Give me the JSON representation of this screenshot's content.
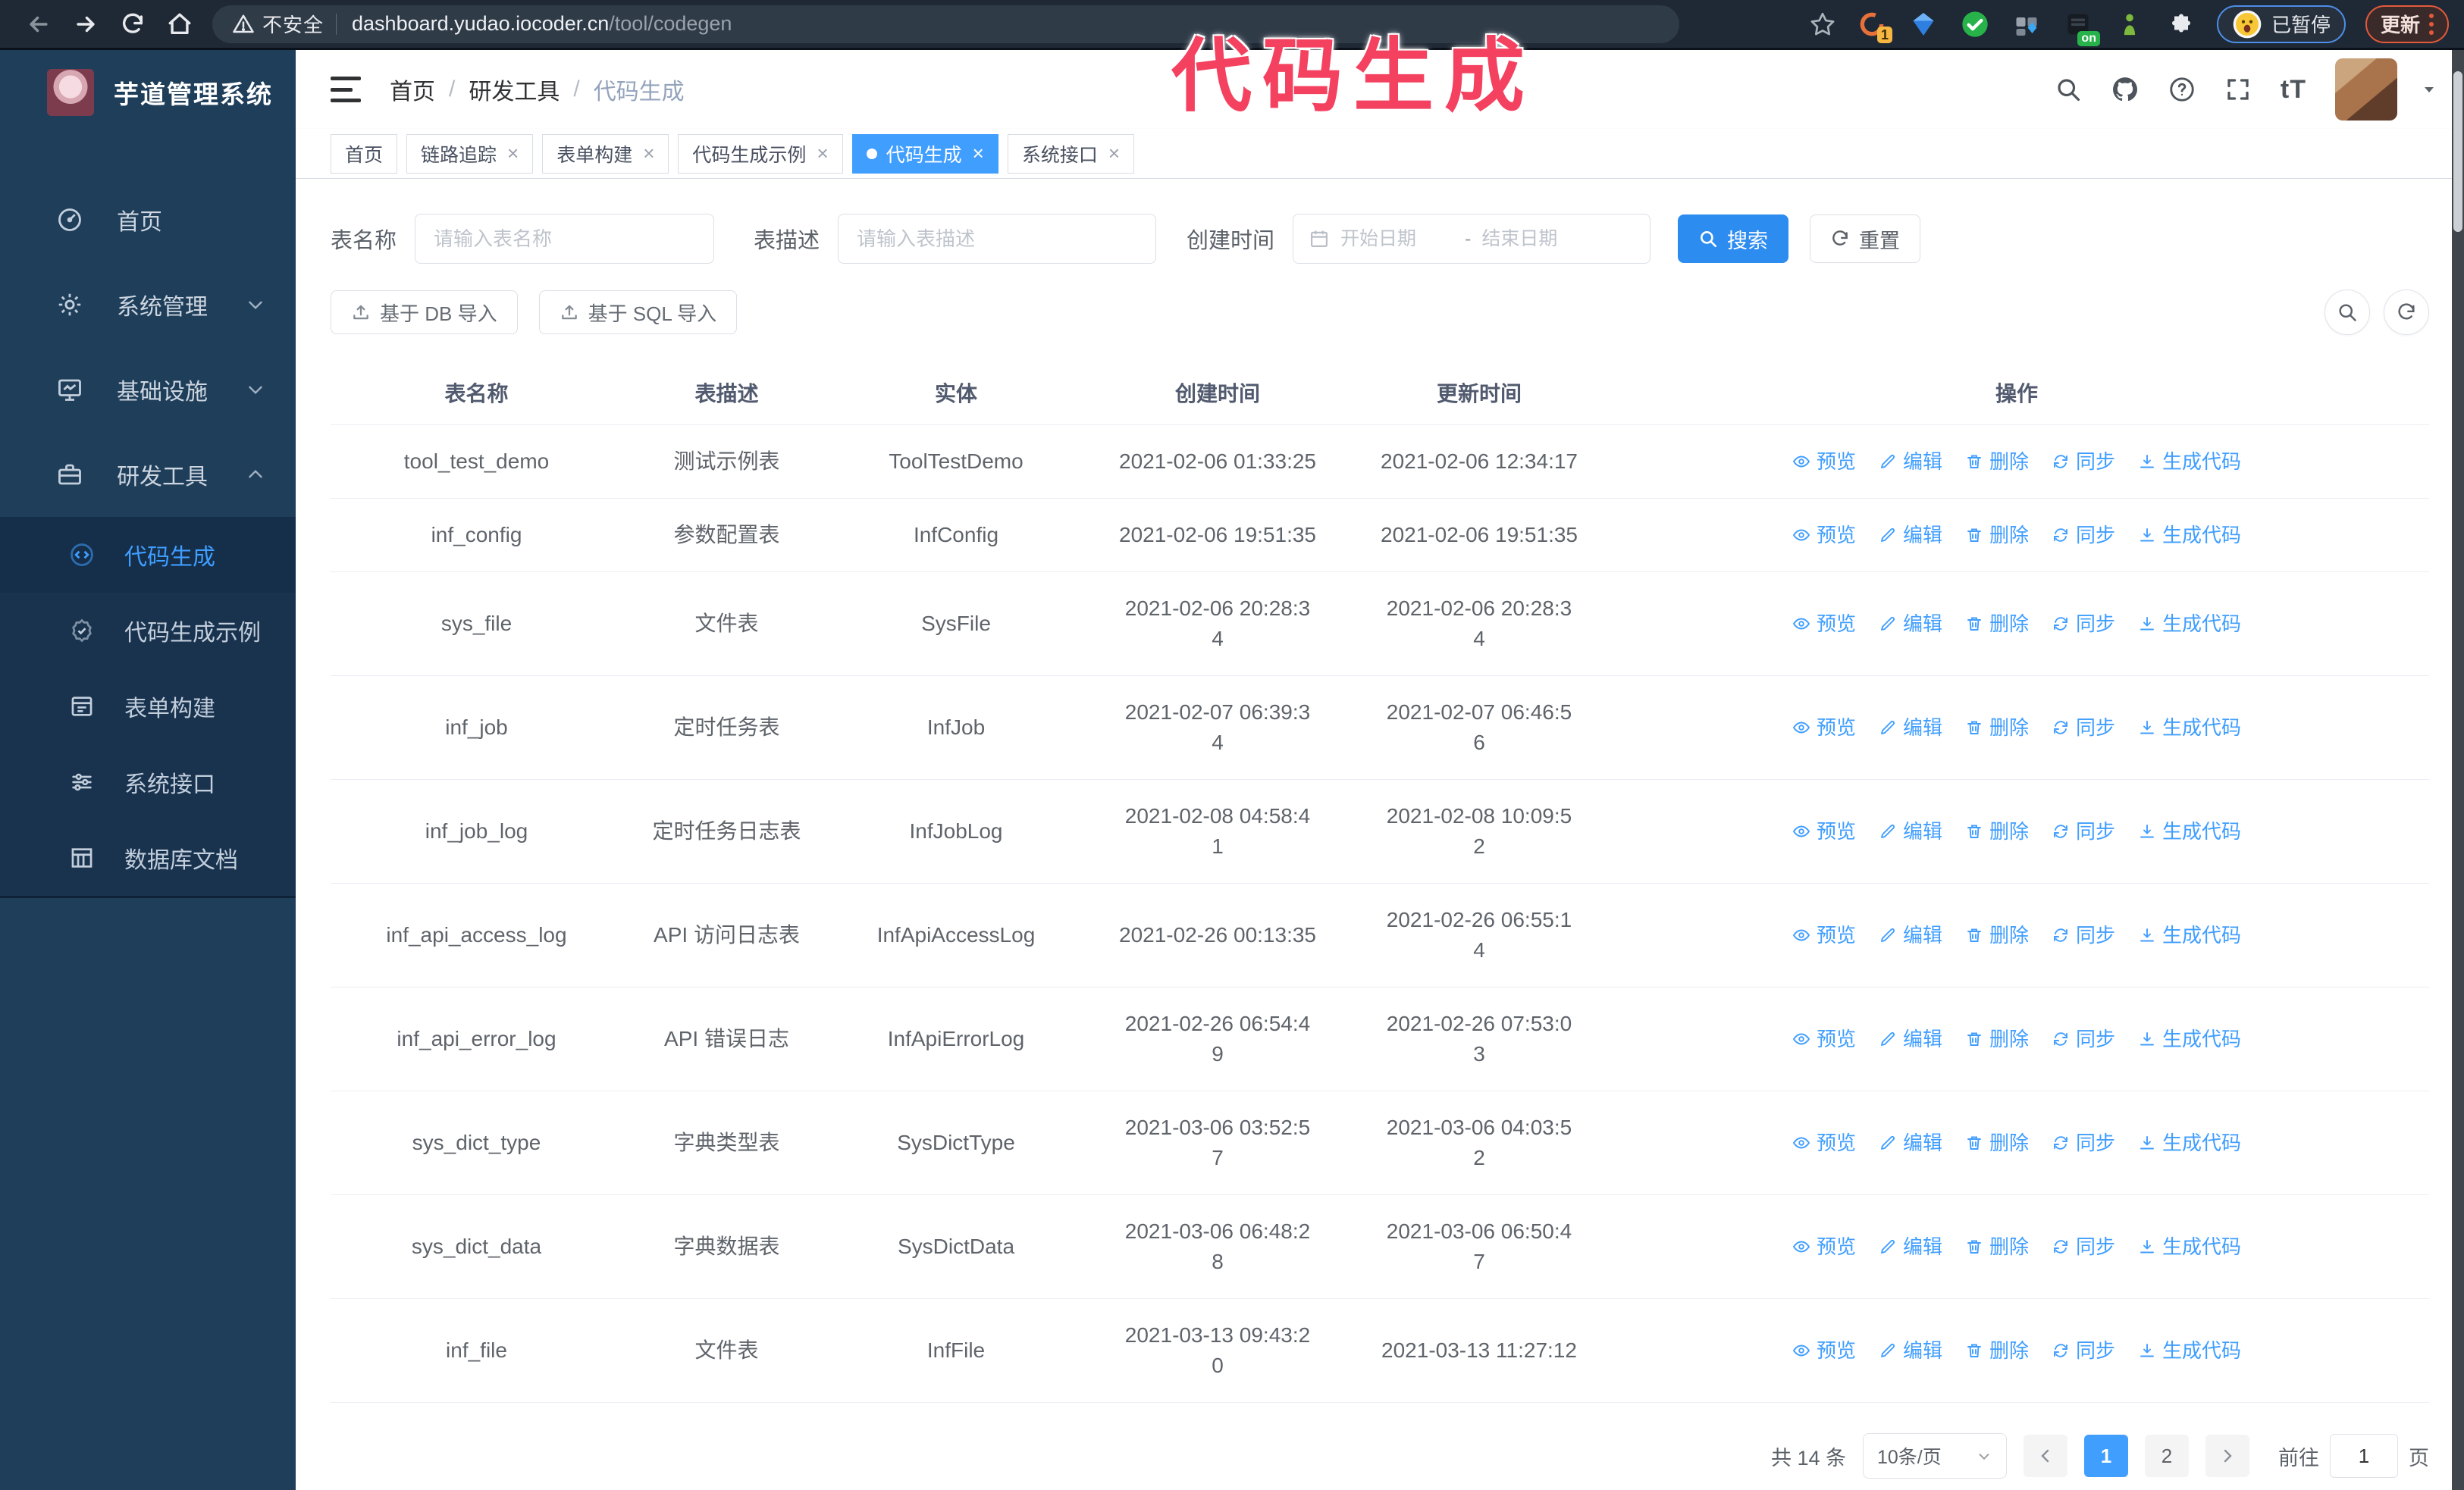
{
  "browser": {
    "security_label": "不安全",
    "url_host": "dashboard.yudao.iocoder.cn",
    "url_path": "/tool/codegen",
    "ext_badge_1": "1",
    "ext_badge_on": "on",
    "profile_badge": "已暂停",
    "update_button": "更新"
  },
  "overlay": {
    "text": "代码生成",
    "color": "#f4415f"
  },
  "sidebar": {
    "logo_title": "芋道管理系统",
    "items": [
      {
        "label": "首页",
        "icon": "dashboard-icon"
      },
      {
        "label": "系统管理",
        "icon": "gear-icon"
      },
      {
        "label": "基础设施",
        "icon": "monitor-icon"
      },
      {
        "label": "研发工具",
        "icon": "toolbox-icon"
      }
    ],
    "subitems": [
      {
        "label": "代码生成",
        "icon": "code-icon",
        "active": true
      },
      {
        "label": "代码生成示例",
        "icon": "badge-check-icon"
      },
      {
        "label": "表单构建",
        "icon": "form-icon"
      },
      {
        "label": "系统接口",
        "icon": "sliders-icon"
      },
      {
        "label": "数据库文档",
        "icon": "db-table-icon"
      }
    ]
  },
  "breadcrumb": [
    "首页",
    "研发工具",
    "代码生成"
  ],
  "tabs": [
    {
      "label": "首页",
      "closable": false,
      "active": false
    },
    {
      "label": "链路追踪",
      "closable": true,
      "active": false
    },
    {
      "label": "表单构建",
      "closable": true,
      "active": false
    },
    {
      "label": "代码生成示例",
      "closable": true,
      "active": false
    },
    {
      "label": "代码生成",
      "closable": true,
      "active": true
    },
    {
      "label": "系统接口",
      "closable": true,
      "active": false
    }
  ],
  "search": {
    "name_label": "表名称",
    "name_placeholder": "请输入表名称",
    "desc_label": "表描述",
    "desc_placeholder": "请输入表描述",
    "time_label": "创建时间",
    "start_placeholder": "开始日期",
    "range_separator": "-",
    "end_placeholder": "结束日期",
    "search_button": "搜索",
    "reset_button": "重置"
  },
  "toolbar": {
    "import_db": "基于 DB 导入",
    "import_sql": "基于 SQL 导入"
  },
  "table": {
    "columns": [
      "表名称",
      "表描述",
      "实体",
      "创建时间",
      "更新时间",
      "操作"
    ],
    "actions": [
      "预览",
      "编辑",
      "删除",
      "同步",
      "生成代码"
    ],
    "rows": [
      {
        "name": "tool_test_demo",
        "desc": "测试示例表",
        "entity": "ToolTestDemo",
        "created": [
          "2021-02-06 01:33:25"
        ],
        "updated": [
          "2021-02-06 12:34:17"
        ]
      },
      {
        "name": "inf_config",
        "desc": "参数配置表",
        "entity": "InfConfig",
        "created": [
          "2021-02-06 19:51:35"
        ],
        "updated": [
          "2021-02-06 19:51:35"
        ]
      },
      {
        "name": "sys_file",
        "desc": "文件表",
        "entity": "SysFile",
        "created": [
          "2021-02-06 20:28:3",
          "4"
        ],
        "updated": [
          "2021-02-06 20:28:3",
          "4"
        ]
      },
      {
        "name": "inf_job",
        "desc": "定时任务表",
        "entity": "InfJob",
        "created": [
          "2021-02-07 06:39:3",
          "4"
        ],
        "updated": [
          "2021-02-07 06:46:5",
          "6"
        ]
      },
      {
        "name": "inf_job_log",
        "desc": "定时任务日志表",
        "entity": "InfJobLog",
        "created": [
          "2021-02-08 04:58:4",
          "1"
        ],
        "updated": [
          "2021-02-08 10:09:5",
          "2"
        ]
      },
      {
        "name": "inf_api_access_log",
        "desc": "API 访问日志表",
        "entity": "InfApiAccessLog",
        "created": [
          "2021-02-26 00:13:35"
        ],
        "updated": [
          "2021-02-26 06:55:1",
          "4"
        ]
      },
      {
        "name": "inf_api_error_log",
        "desc": "API 错误日志",
        "entity": "InfApiErrorLog",
        "created": [
          "2021-02-26 06:54:4",
          "9"
        ],
        "updated": [
          "2021-02-26 07:53:0",
          "3"
        ]
      },
      {
        "name": "sys_dict_type",
        "desc": "字典类型表",
        "entity": "SysDictType",
        "created": [
          "2021-03-06 03:52:5",
          "7"
        ],
        "updated": [
          "2021-03-06 04:03:5",
          "2"
        ]
      },
      {
        "name": "sys_dict_data",
        "desc": "字典数据表",
        "entity": "SysDictData",
        "created": [
          "2021-03-06 06:48:2",
          "8"
        ],
        "updated": [
          "2021-03-06 06:50:4",
          "7"
        ]
      },
      {
        "name": "inf_file",
        "desc": "文件表",
        "entity": "InfFile",
        "created": [
          "2021-03-13 09:43:2",
          "0"
        ],
        "updated": [
          "2021-03-13 11:27:12"
        ]
      }
    ]
  },
  "pagination": {
    "total": "共 14 条",
    "page_size": "10条/页",
    "pages": [
      "1",
      "2"
    ],
    "active_page": "1",
    "goto_label": "前往",
    "goto_value": "1",
    "goto_suffix": "页"
  }
}
